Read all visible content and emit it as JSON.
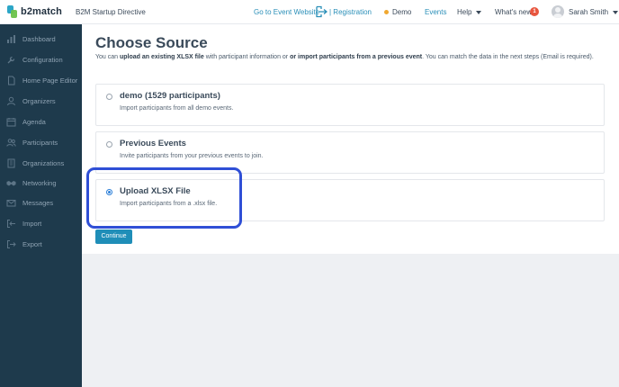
{
  "header": {
    "logo_text": "b2match",
    "org_name": "B2M Startup Directive",
    "go_to_event": "Go to Event Website",
    "registration": "| Registration",
    "demo": "Demo",
    "events": "Events",
    "help": "Help",
    "whats_new": "What's new",
    "whats_new_count": "1",
    "user_name": "Sarah Smith",
    "colors": {
      "link": "#2a8fb8",
      "demo_dot": "#f0a830",
      "badge": "#e8553e"
    }
  },
  "sidebar": {
    "background": "#1e3a4c",
    "items": [
      {
        "label": "Dashboard",
        "icon": "bar-chart-icon"
      },
      {
        "label": "Configuration",
        "icon": "wrench-icon"
      },
      {
        "label": "Home Page Editor",
        "icon": "document-icon"
      },
      {
        "label": "Organizers",
        "icon": "user-icon"
      },
      {
        "label": "Agenda",
        "icon": "calendar-icon"
      },
      {
        "label": "Participants",
        "icon": "users-icon"
      },
      {
        "label": "Organizations",
        "icon": "building-icon"
      },
      {
        "label": "Networking",
        "icon": "handshake-icon"
      },
      {
        "label": "Messages",
        "icon": "envelope-icon"
      },
      {
        "label": "Import",
        "icon": "import-icon"
      },
      {
        "label": "Export",
        "icon": "export-icon"
      }
    ]
  },
  "main": {
    "title": "Choose Source",
    "subtitle": {
      "part1": "You can ",
      "bold1": "upload an existing XLSX file",
      "part2": " with participant information or ",
      "bold2": "or import participants from a previous event",
      "part3": ". You can match the data in the next steps (Email is required)."
    },
    "options": [
      {
        "title": "demo (1529 participants)",
        "description": "Import participants from all demo events.",
        "selected": false
      },
      {
        "title": "Previous Events",
        "description": "Invite participants from your previous events to join.",
        "selected": false
      },
      {
        "title": "Upload XLSX File",
        "description": "Import participants from a .xlsx file.",
        "selected": true
      }
    ],
    "continue_label": "Continue",
    "colors": {
      "button": "#1f8eb8",
      "highlight": "#2f4fd6",
      "radio_selected": "#2b7fd8"
    }
  }
}
